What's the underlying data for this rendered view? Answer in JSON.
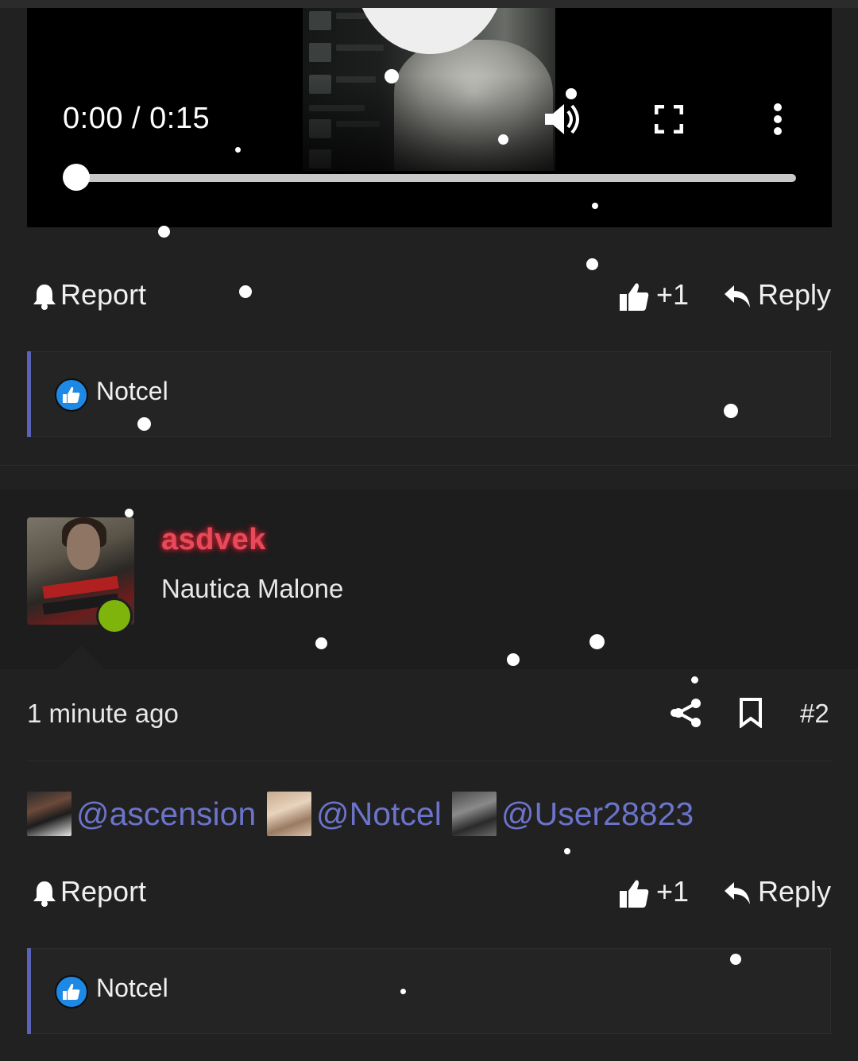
{
  "video": {
    "time_display": "0:00 / 0:15",
    "progress": 0,
    "icons": [
      "volume-icon",
      "fullscreen-icon",
      "more-vertical-icon"
    ]
  },
  "post1_actions": {
    "report_label": "Report",
    "like_label": "+1",
    "reply_label": "Reply"
  },
  "post1_reactions": {
    "reactor": "Notcel"
  },
  "post2": {
    "username": "asdvek",
    "user_title": "Nautica Malone",
    "online": true,
    "timestamp": "1 minute ago",
    "post_number": "#2",
    "mentions": [
      {
        "name": "@ascension"
      },
      {
        "name": "@Notcel"
      },
      {
        "name": "@User28823"
      }
    ],
    "actions": {
      "report_label": "Report",
      "like_label": "+1",
      "reply_label": "Reply"
    },
    "reactions": {
      "reactor": "Notcel"
    }
  },
  "colors": {
    "background": "#212122",
    "accent_blue": "#5a63b8",
    "mention_link": "#6b74c9",
    "username_red": "#e64a5b",
    "online_green": "#7fb40d",
    "like_badge": "#1e88e5"
  }
}
